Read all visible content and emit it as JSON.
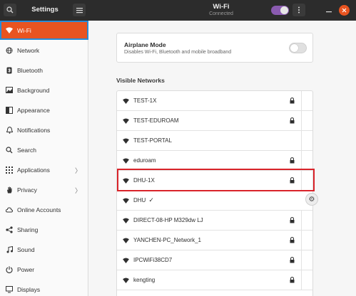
{
  "header": {
    "left_title": "Settings",
    "title": "Wi-Fi",
    "subtitle": "Connected",
    "wifi_toggle_on": true
  },
  "sidebar": {
    "items": [
      {
        "label": "Wi-Fi",
        "icon": "wifi-icon",
        "active": true
      },
      {
        "label": "Network",
        "icon": "network-icon"
      },
      {
        "label": "Bluetooth",
        "icon": "bluetooth-icon"
      },
      {
        "label": "Background",
        "icon": "background-icon"
      },
      {
        "label": "Appearance",
        "icon": "appearance-icon"
      },
      {
        "label": "Notifications",
        "icon": "bell-icon"
      },
      {
        "label": "Search",
        "icon": "search-icon"
      },
      {
        "label": "Applications",
        "icon": "grid-icon",
        "chevron": true
      },
      {
        "label": "Privacy",
        "icon": "hand-icon",
        "chevron": true
      },
      {
        "label": "Online Accounts",
        "icon": "cloud-icon"
      },
      {
        "label": "Sharing",
        "icon": "share-icon"
      },
      {
        "label": "Sound",
        "icon": "music-icon"
      },
      {
        "label": "Power",
        "icon": "power-icon"
      },
      {
        "label": "Displays",
        "icon": "display-icon"
      }
    ]
  },
  "airplane": {
    "title": "Airplane Mode",
    "description": "Disables Wi-Fi, Bluetooth and mobile broadband",
    "enabled": false
  },
  "networks_label": "Visible Networks",
  "networks": [
    {
      "name": "TEST-1X",
      "secured": true
    },
    {
      "name": "TEST-EDUROAM",
      "secured": true
    },
    {
      "name": "TEST-PORTAL",
      "secured": false
    },
    {
      "name": "eduroam",
      "secured": true
    },
    {
      "name": "DHU-1X",
      "secured": true
    },
    {
      "name": "DHU",
      "secured": false,
      "connected": true,
      "check": "✓"
    },
    {
      "name": "DIRECT-08-HP M329dw LJ",
      "secured": true
    },
    {
      "name": "YANCHEN-PC_Network_1",
      "secured": true
    },
    {
      "name": "IPCWiFi38CD7",
      "secured": true
    },
    {
      "name": "kengting",
      "secured": true
    }
  ],
  "colors": {
    "accent": "#e95420",
    "header_bg": "#2c2c2c",
    "highlight_red": "#d9232a",
    "selection_blue": "#2a8cd6"
  }
}
